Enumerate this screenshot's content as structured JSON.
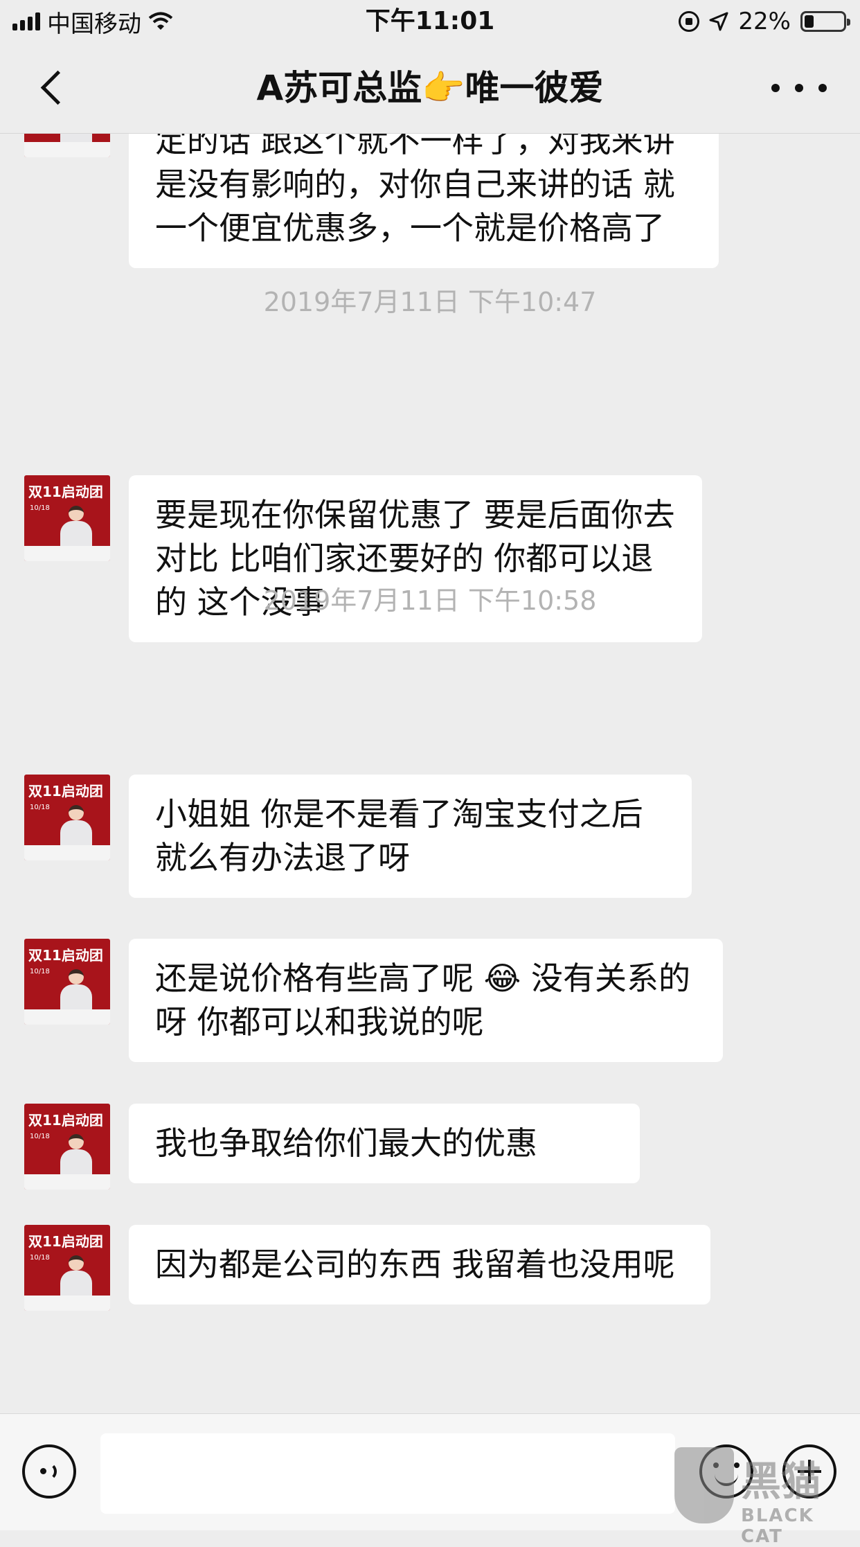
{
  "status_bar": {
    "carrier": "中国移动",
    "time": "下午11:01",
    "battery_percent": "22%",
    "battery_level": 0.22,
    "icons": [
      "signal-icon",
      "wifi-icon",
      "orientation-lock-icon",
      "location-icon",
      "battery-icon"
    ]
  },
  "nav": {
    "title": "A苏可总监👉唯一彼爱",
    "icons": [
      "back-icon",
      "more-icon"
    ]
  },
  "chat": {
    "partial_message": "美女 你现在是保留优惠的，要是后面定的话 跟这个就不一样了，对我来讲是没有影响的，对你自己来讲的话 就一个便宜优惠多，一个就是价格高了",
    "timestamp_1": "2019年7月11日 下午10:47",
    "message_1": "要是现在你保留优惠了  要是后面你去对比 比咱们家还要好的 你都可以退的  这个没事",
    "timestamp_2": "2019年7月11日 下午10:58",
    "message_2": "小姐姐 你是不是看了淘宝支付之后就么有办法退了呀",
    "message_3": "还是说价格有些高了呢 😂  没有关系的呀   你都可以和我说的呢",
    "message_4": "我也争取给你们最大的优惠",
    "message_5": "因为都是公司的东西   我留着也没用呢",
    "avatar_text": "双11启动团",
    "avatar_date": "10/18"
  },
  "input_bar": {
    "placeholder": "",
    "icons": [
      "voice-icon",
      "emoji-icon",
      "plus-icon"
    ]
  },
  "watermark": {
    "text": "黑猫",
    "subtext": "BLACK CAT"
  },
  "colors": {
    "background": "#ededed",
    "bubble": "#ffffff",
    "avatar": "#a8141b",
    "timestamp": "#b3b3b3"
  }
}
